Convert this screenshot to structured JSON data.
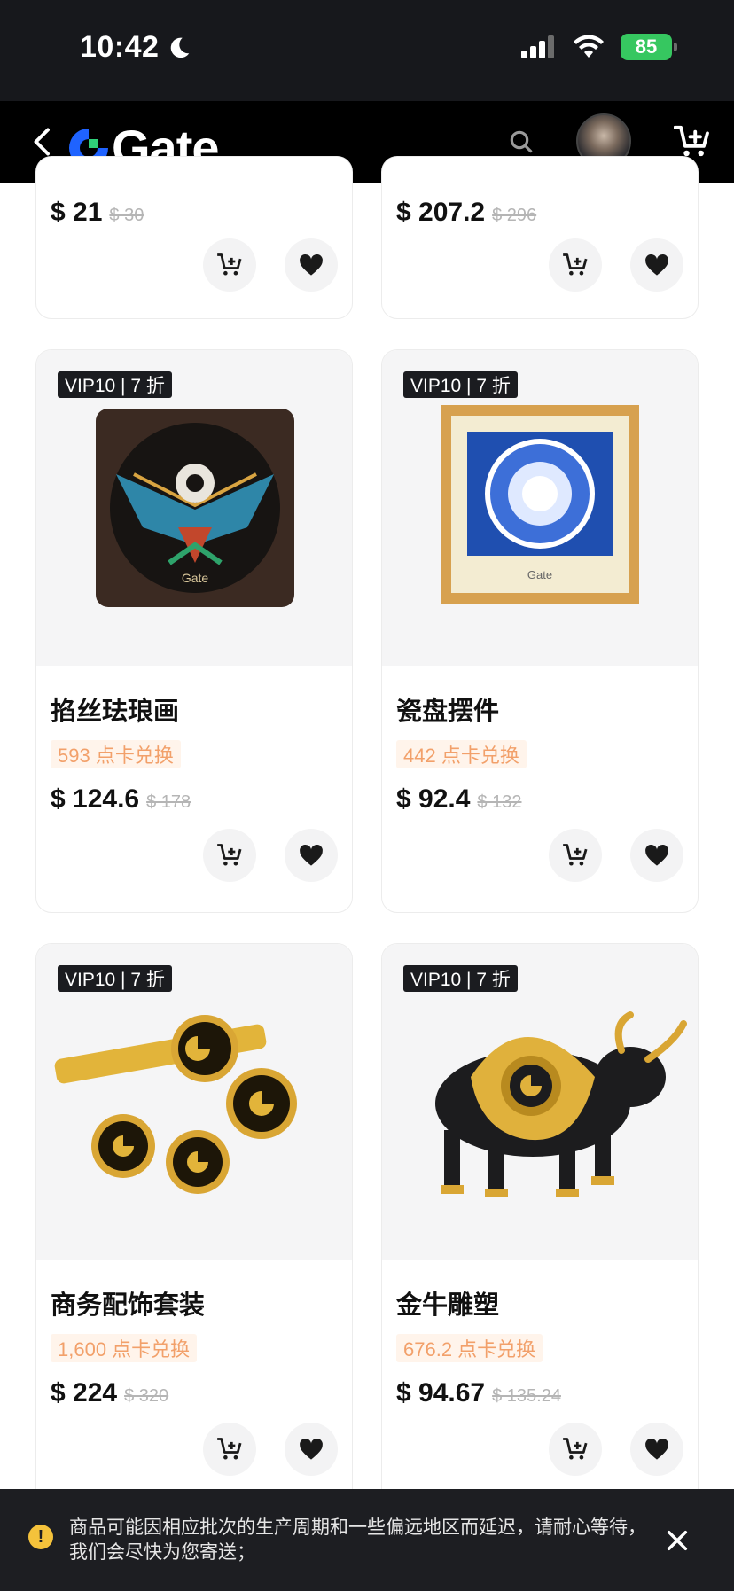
{
  "status_bar": {
    "time": "10:42",
    "battery": "85"
  },
  "nav": {
    "logo_text": "Gate"
  },
  "products": [
    {
      "vip": "",
      "title": "",
      "points": "",
      "price": "$ 21",
      "old_price": "$ 30"
    },
    {
      "vip": "",
      "title": "",
      "points": "",
      "price": "$ 207.2",
      "old_price": "$ 296"
    },
    {
      "vip": "VIP10 | 7 折",
      "title": "掐丝珐琅画",
      "points": "593 点卡兑换",
      "price": "$ 124.6",
      "old_price": "$ 178"
    },
    {
      "vip": "VIP10 | 7 折",
      "title": "瓷盘摆件",
      "points": "442 点卡兑换",
      "price": "$ 92.4",
      "old_price": "$ 132"
    },
    {
      "vip": "VIP10 | 7 折",
      "title": "商务配饰套装",
      "points": "1,600 点卡兑换",
      "price": "$ 224",
      "old_price": "$ 320"
    },
    {
      "vip": "VIP10 | 7 折",
      "title": "金牛雕塑",
      "points": "676.2 点卡兑换",
      "price": "$ 94.67",
      "old_price": "$ 135.24"
    }
  ],
  "toast": {
    "icon": "!",
    "message": "商品可能因相应批次的生产周期和一些偏远地区而延迟，请耐心等待，我们会尽快为您寄送；"
  },
  "colors": {
    "accent_blue": "#1f63ff",
    "points_orange": "#f2a06a",
    "battery_green": "#36c760"
  }
}
